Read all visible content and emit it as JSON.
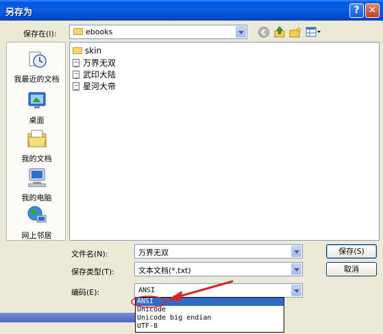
{
  "window": {
    "title": "另存为",
    "help_label": "?",
    "close_label": "✕"
  },
  "save_in": {
    "label": "保存在(I):",
    "value": "ebooks"
  },
  "toolbar": {
    "icons": [
      "back-icon",
      "up-folder-icon",
      "new-folder-icon",
      "views-menu-icon"
    ]
  },
  "places": [
    {
      "label": "我最近的文档",
      "icon": "recent-documents-icon"
    },
    {
      "label": "桌面",
      "icon": "desktop-icon"
    },
    {
      "label": "我的文档",
      "icon": "my-documents-icon"
    },
    {
      "label": "我的电脑",
      "icon": "my-computer-icon"
    },
    {
      "label": "网上邻居",
      "icon": "network-places-icon"
    }
  ],
  "files": [
    {
      "name": "skin",
      "type": "folder"
    },
    {
      "name": "万界无双",
      "type": "text"
    },
    {
      "name": "武印大陆",
      "type": "text"
    },
    {
      "name": "星河大帝",
      "type": "text"
    }
  ],
  "filename": {
    "label": "文件名(N):",
    "value": "万界无双"
  },
  "filetype": {
    "label": "保存类型(T):",
    "value": "文本文档(*.txt)"
  },
  "encoding": {
    "label": "编码(E):",
    "value": "ANSI",
    "options": [
      "ANSI",
      "Unicode",
      "Unicode big endian",
      "UTF-8"
    ],
    "selected_index": 0
  },
  "buttons": {
    "save": "保存(S)",
    "cancel": "取消"
  },
  "annotation_color": "#e02020"
}
